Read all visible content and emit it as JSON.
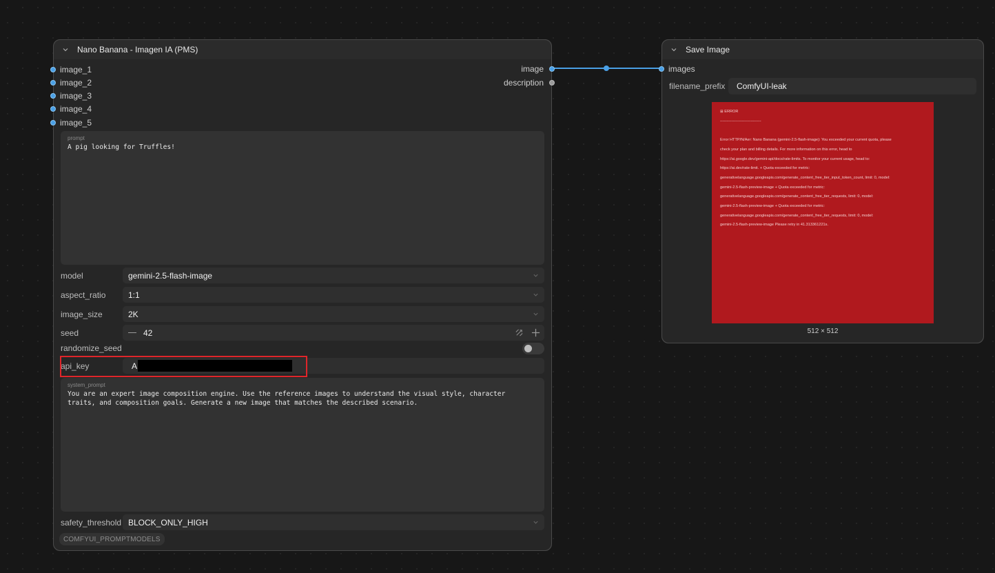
{
  "colors": {
    "canvas": "#171717",
    "link": "#4aa0e6",
    "error_bg": "#b0191e",
    "highlight": "#e0252a"
  },
  "node1": {
    "title": "Nano Banana - Imagen IA (PMS)",
    "inputs": [
      "image_1",
      "image_2",
      "image_3",
      "image_4",
      "image_5"
    ],
    "outputs": [
      "image",
      "description"
    ],
    "prompt": {
      "label": "prompt",
      "value": "A pig looking for Truffles!"
    },
    "widgets": {
      "model": {
        "label": "model",
        "value": "gemini-2.5-flash-image"
      },
      "aspect_ratio": {
        "label": "aspect_ratio",
        "value": "1:1"
      },
      "image_size": {
        "label": "image_size",
        "value": "2K"
      },
      "seed": {
        "label": "seed",
        "value": "42"
      },
      "randomize_seed": {
        "label": "randomize_seed"
      },
      "api_key": {
        "label": "api_key",
        "value": "A"
      },
      "safety_threshold": {
        "label": "safety_threshold",
        "value": "BLOCK_ONLY_HIGH"
      }
    },
    "system_prompt": {
      "label": "system_prompt",
      "value": "You are an expert image composition engine. Use the reference images to understand the visual style, character\ntraits, and composition goals. Generate a new image that matches the described scenario."
    },
    "badge": "COMFYUI_PROMPTMODELS"
  },
  "node2": {
    "title": "Save Image",
    "input": "images",
    "filename_prefix": {
      "label": "filename_prefix",
      "value": "ComfyUI-leak"
    },
    "preview_size": "512 × 512",
    "error_lines": [
      "⊞ ERROR",
      "--------------------------------",
      "",
      "Error HTTP/N/Aer: Nano Banana (gemini-2.5-flash-image): You exceeded your current quota, please",
      "check your plan and billing details. For more information on this error, head to",
      "https://ai.google.dev/gemini-api/docs/rate-limits. To monitor your current usage, head to:",
      "https://ai.dev/rate-limit. + Quota exceeded for metric:",
      "generativelanguage.googleapis.com/generate_content_free_tier_input_token_count, limit: 0, model:",
      "gemini-2.5-flash-preview-image + Quota exceeded for metric:",
      "generativelanguage.googleapis.com/generate_content_free_tier_requests, limit: 0, model:",
      "gemini-2.5-flash-preview-image + Quota exceeded for metric:",
      "generativelanguage.googleapis.com/generate_content_free_tier_requests, limit: 0, model:",
      "gemini-2.5-flash-preview-image Please retry in 41.313361221s."
    ]
  }
}
